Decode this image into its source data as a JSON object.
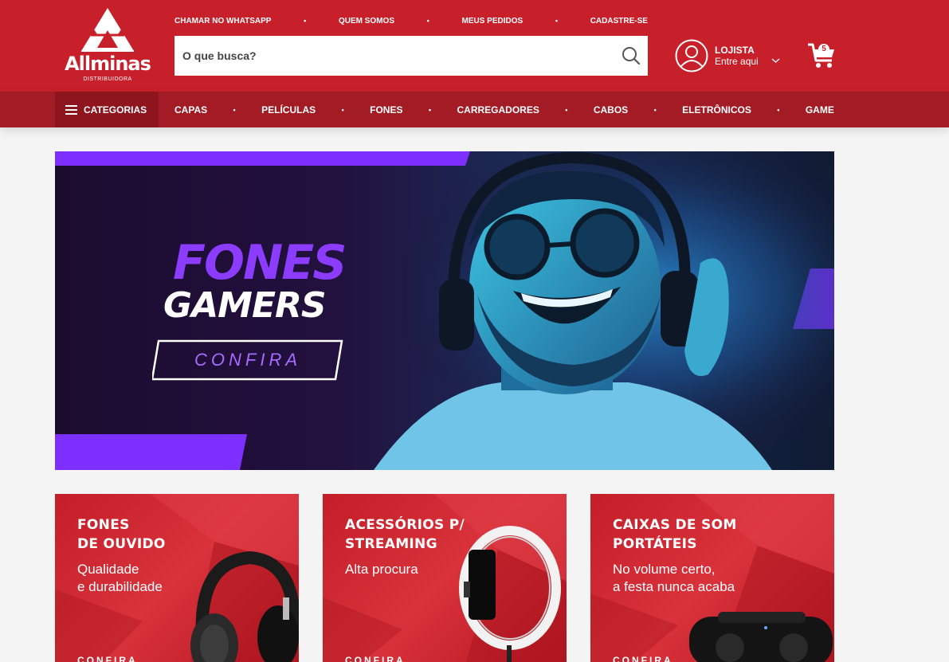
{
  "brand": {
    "name": "Allminas",
    "tagline": "DISTRIBUIDORA",
    "color": "#c8202a"
  },
  "toplinks": [
    "CHAMAR NO WHATSAPP",
    "QUEM SOMOS",
    "MEUS PEDIDOS",
    "CADASTRE-SE"
  ],
  "search": {
    "placeholder": "O que busca?",
    "value": ""
  },
  "account": {
    "title": "LOJISTA",
    "subtitle": "Entre aqui"
  },
  "cart": {
    "count": "5"
  },
  "nav": {
    "categories_label": "CATEGORIAS",
    "items": [
      "CAPAS",
      "PELÍCULAS",
      "FONES",
      "CARREGADORES",
      "CABOS",
      "ELETRÔNICOS",
      "GAME"
    ]
  },
  "hero": {
    "line1": "FONES",
    "line2": "GAMERS",
    "cta": "CONFIRA",
    "accent": "#8b3cff"
  },
  "cards": [
    {
      "title": "FONES\nDE OUVIDO",
      "desc": "Qualidade\ne durabilidade",
      "cta": "CONFIRA"
    },
    {
      "title": "ACESSÓRIOS P/\nSTREAMING",
      "desc": "Alta procura",
      "cta": "CONFIRA"
    },
    {
      "title": "CAIXAS DE SOM\nPORTÁTEIS",
      "desc": "No volume certo,\na festa nunca acaba",
      "cta": "CONFIRA"
    }
  ]
}
